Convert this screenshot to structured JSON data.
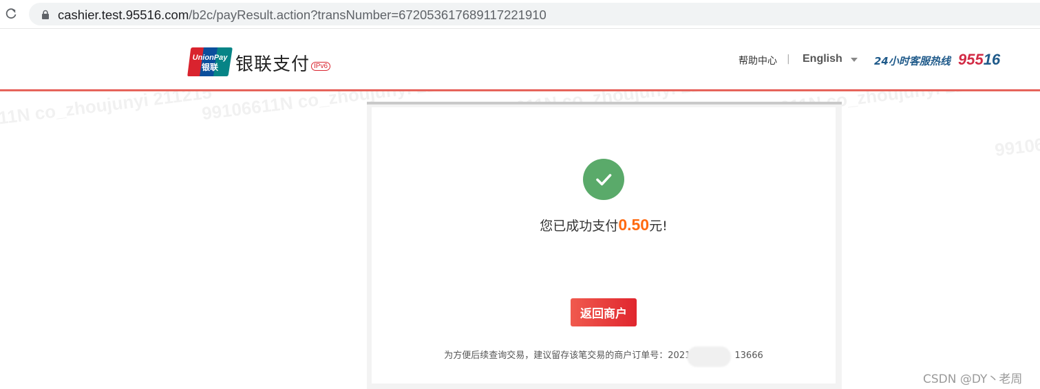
{
  "browser": {
    "url_host": "cashier.test.95516.com",
    "url_path": "/b2c/payResult.action?transNumber=672053617689117221910"
  },
  "header": {
    "logo_text": "UnionPay 银联",
    "brand_name": "银联支付",
    "ipv6_badge": "IPv6",
    "help_link": "帮助中心",
    "separator": "|",
    "language": "English",
    "hotline_label": "24小时客服热线",
    "hotline_number_a": "955",
    "hotline_number_b": "16",
    "accent_color": "#e2453f"
  },
  "watermark": {
    "text": "99106611N co_zhoujunyi 211215"
  },
  "result": {
    "status_icon": "check-icon",
    "message_prefix": "您已成功支付",
    "amount": "0.50",
    "message_suffix": "元!",
    "return_button": "返回商户",
    "order_note_prefix": "为方便后续查询交易，建议留存该笔交易的商户订单号：",
    "order_no_head": "2021",
    "order_no_tail": "13666",
    "success_color": "#5aaa6a",
    "amount_color": "#ff6a10"
  },
  "footer": {
    "csdn_credit": "CSDN @DY丶老周"
  }
}
